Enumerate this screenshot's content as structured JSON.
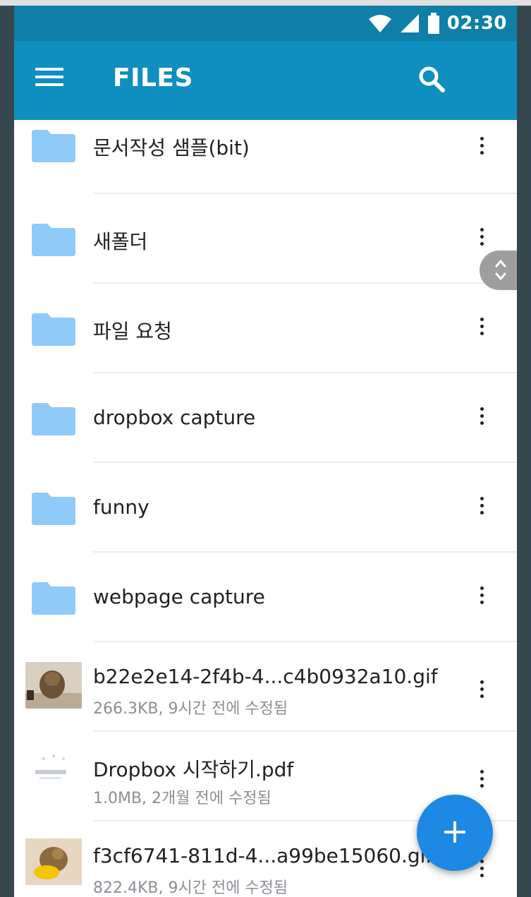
{
  "status_bar": {
    "time": "02:30",
    "icons": [
      "wifi-icon",
      "signal-icon",
      "battery-icon"
    ]
  },
  "app_bar": {
    "title": "FILES",
    "menu_icon": "menu-icon",
    "search_icon": "search-icon"
  },
  "colors": {
    "app_bar": "#0e8fc0",
    "status_bar": "#0e7fa6",
    "folder": "#90caf9",
    "fab": "#1e88e5"
  },
  "items": [
    {
      "type": "folder",
      "name": "문서작성 샘플(bit)"
    },
    {
      "type": "folder",
      "name": "새폴더"
    },
    {
      "type": "folder",
      "name": "파일 요청"
    },
    {
      "type": "folder",
      "name": "dropbox capture"
    },
    {
      "type": "folder",
      "name": "funny"
    },
    {
      "type": "folder",
      "name": "webpage capture"
    },
    {
      "type": "file",
      "name": "b22e2e14-2f4b-4...c4b0932a10.gif",
      "meta": "266.3KB, 9시간 전에 수정됨"
    },
    {
      "type": "file",
      "name": "Dropbox 시작하기.pdf",
      "meta": "1.0MB, 2개월 전에 수정됨"
    },
    {
      "type": "file",
      "name": "f3cf6741-811d-4...a99be15060.gif",
      "meta": "822.4KB, 9시간 전에 수정됨"
    }
  ],
  "fab": {
    "label": "+"
  }
}
